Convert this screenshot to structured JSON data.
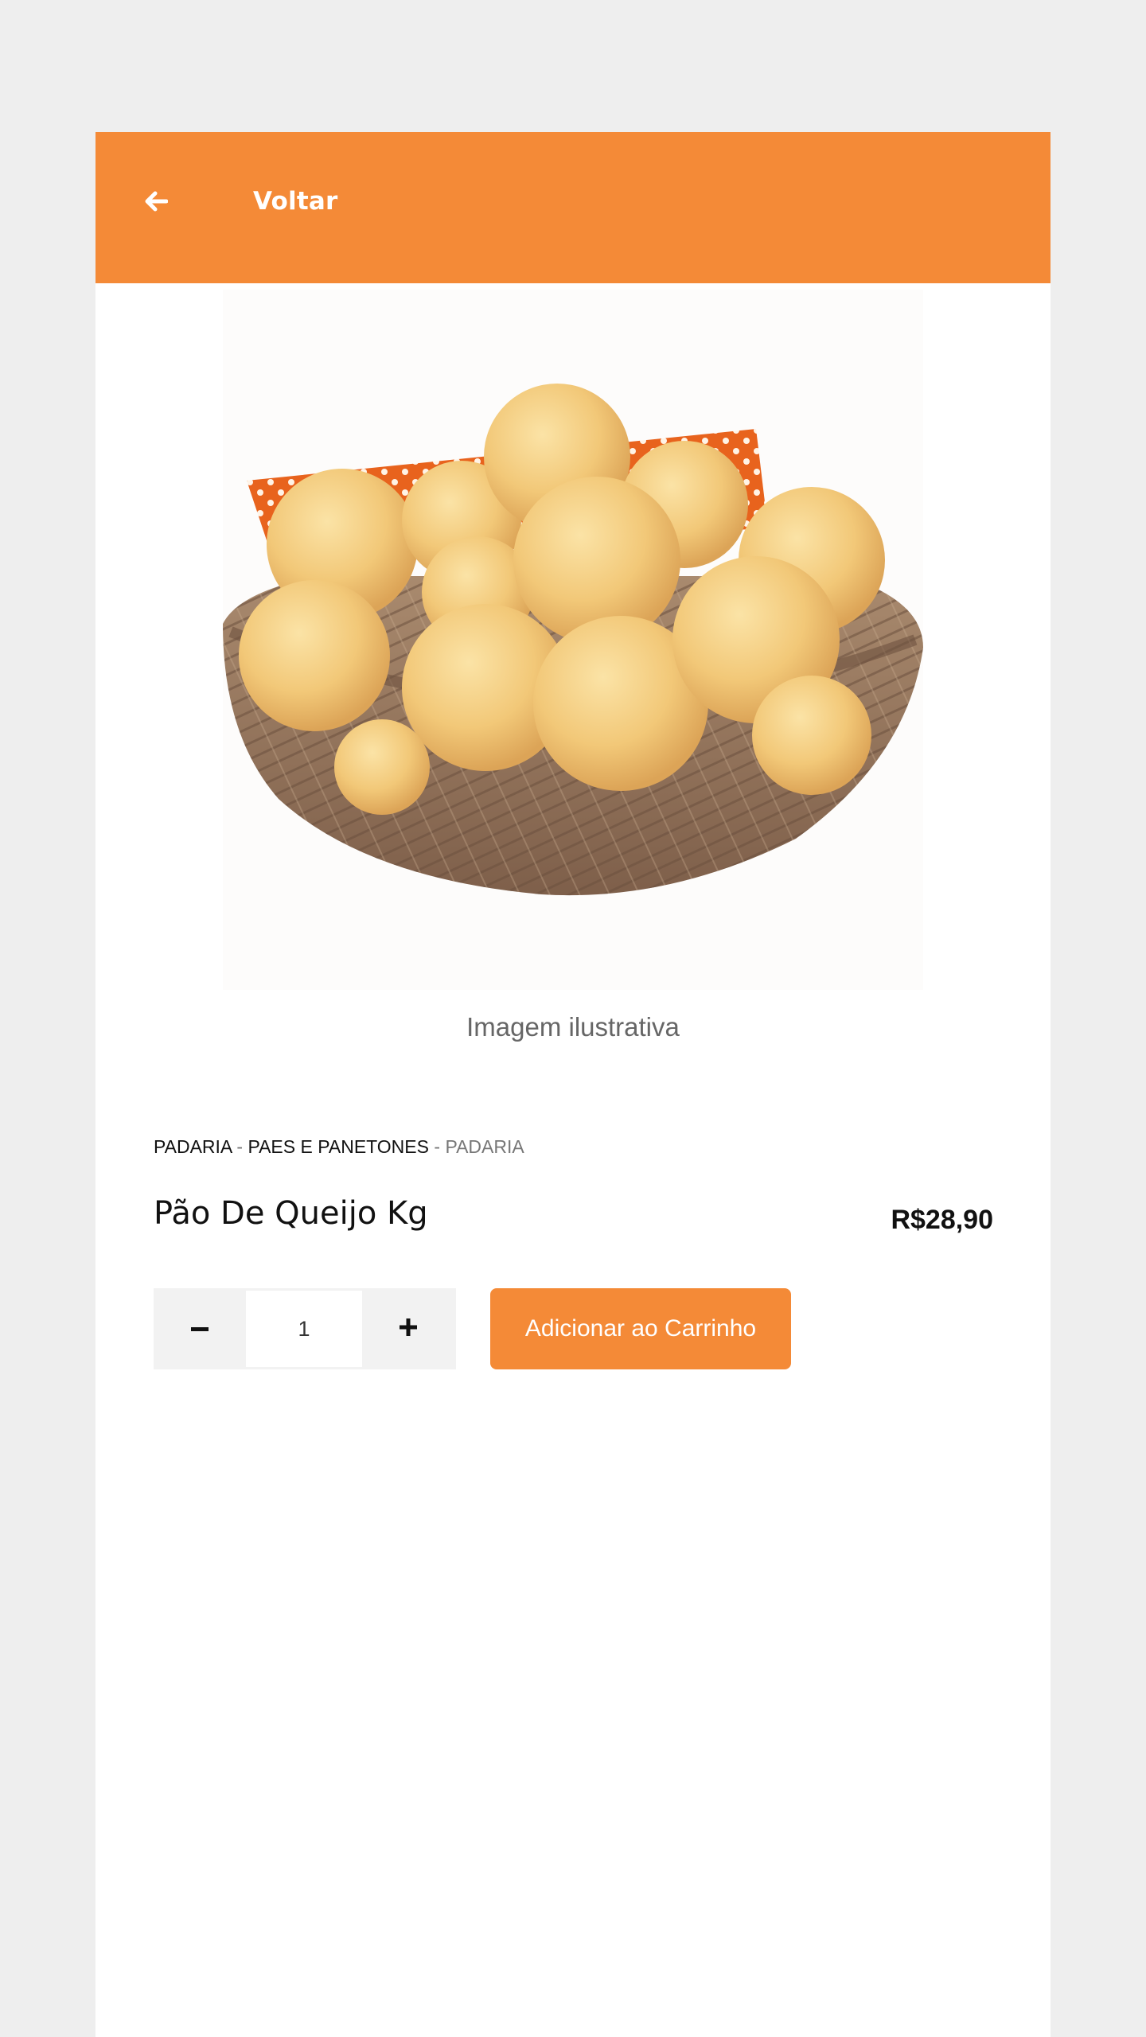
{
  "header": {
    "back_label": "Voltar",
    "back_icon": "arrow-left-icon",
    "background_color": "#f48a37"
  },
  "product": {
    "image_caption": "Imagem ilustrativa",
    "breadcrumb": {
      "department": "PADARIA",
      "category": "PAES E PANETONES",
      "subcategory": "PADARIA",
      "separator": " - "
    },
    "name": "Pão De Queijo Kg",
    "price": "R$28,90"
  },
  "quantity": {
    "decrement_icon": "minus-icon",
    "increment_icon": "plus-icon",
    "value": "1"
  },
  "actions": {
    "add_to_cart_label": "Adicionar ao Carrinho",
    "accent_color": "#f48a37"
  }
}
